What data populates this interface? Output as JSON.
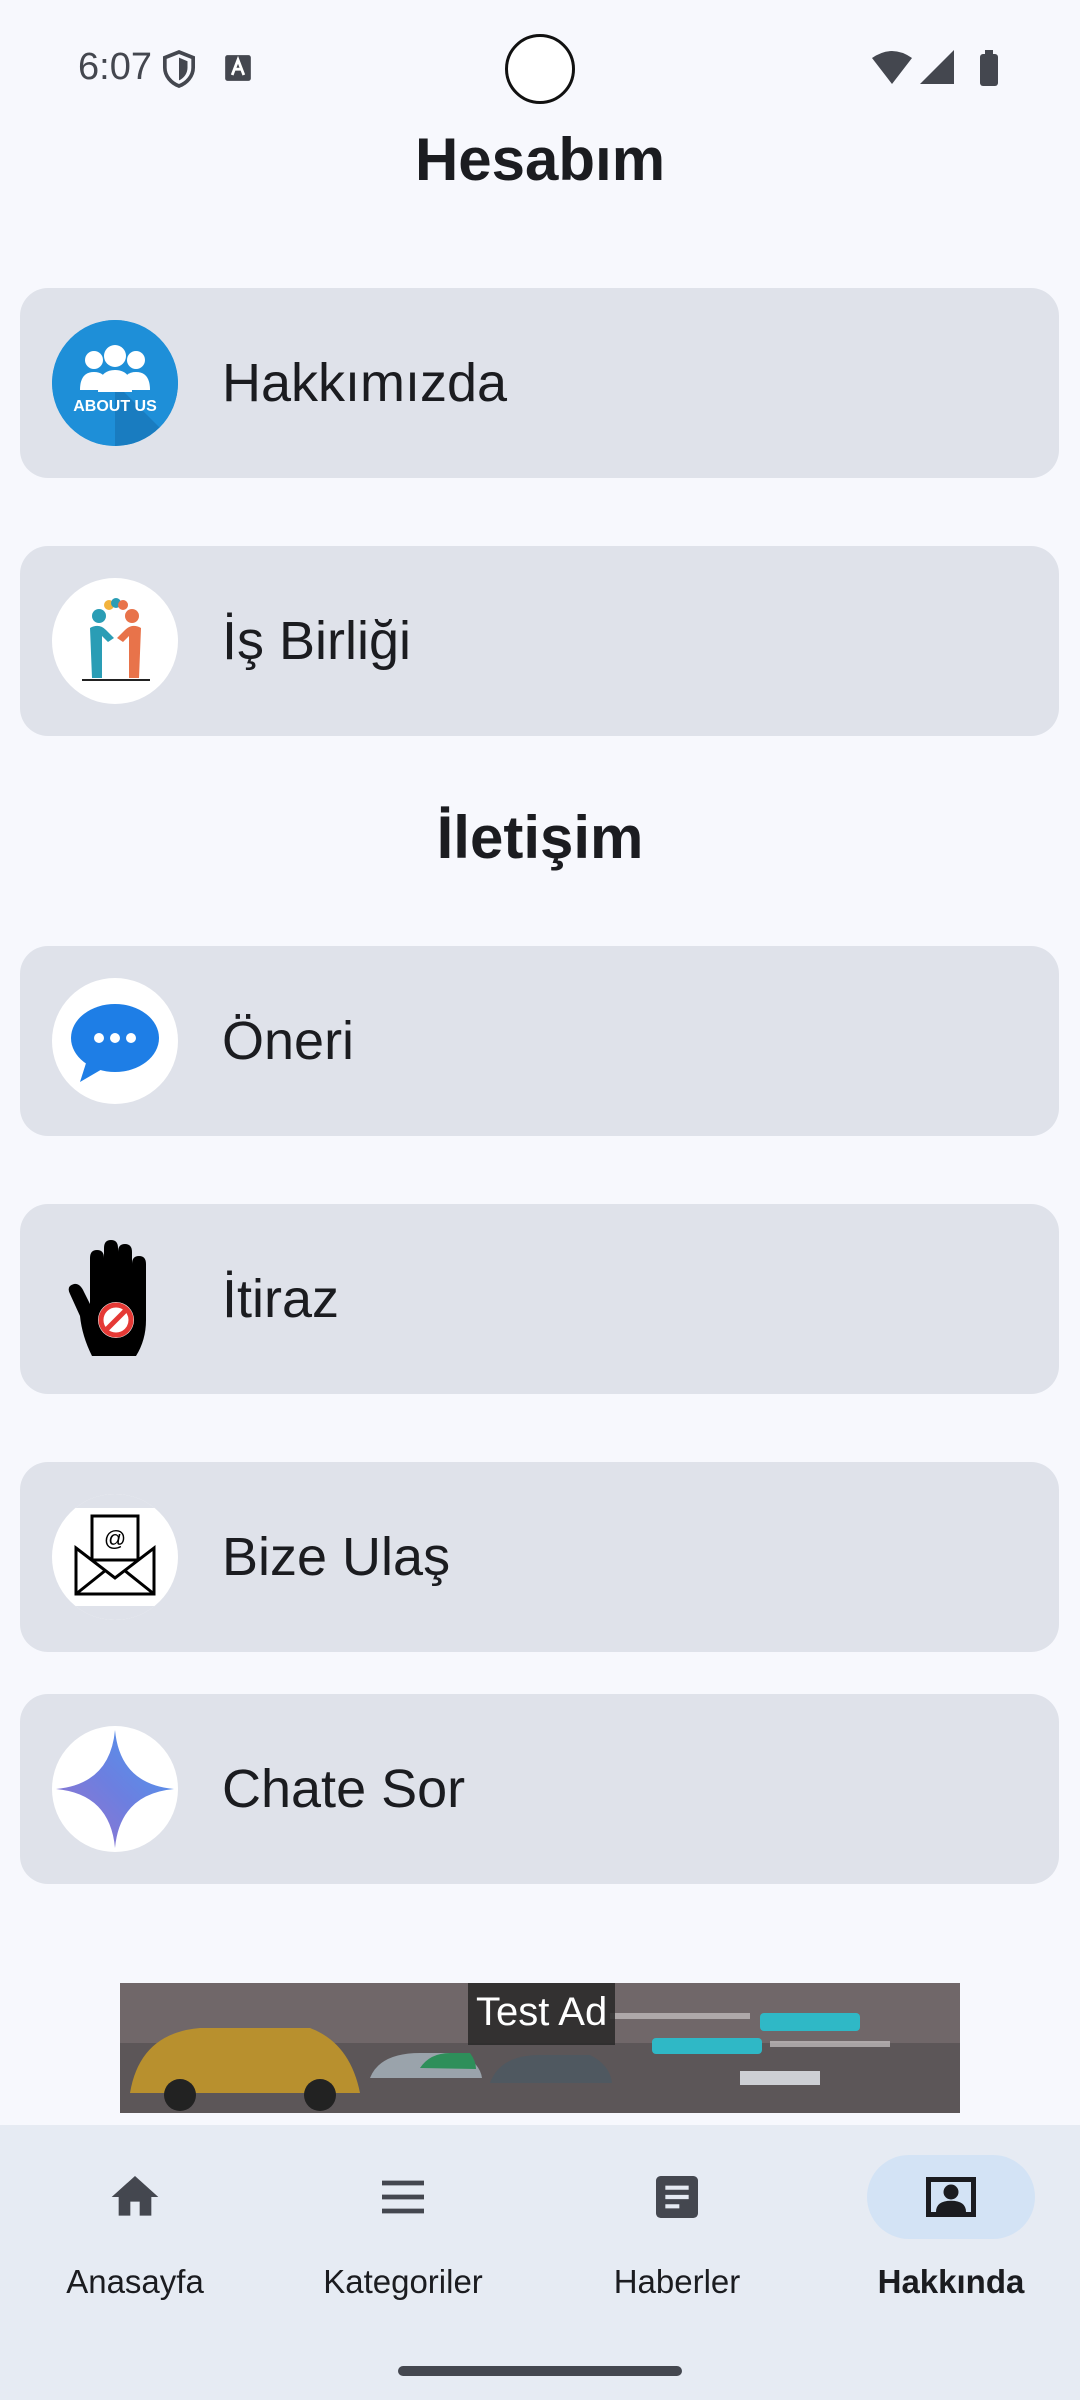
{
  "status_bar": {
    "time": "6:07"
  },
  "header": {
    "title": "Hesabım"
  },
  "account_items": [
    {
      "label": "Hakkımızda",
      "icon": "about-us-icon",
      "icon_text": "ABOUT US"
    },
    {
      "label": "İş Birliği",
      "icon": "handshake-icon"
    }
  ],
  "contact_section": {
    "title": "İletişim"
  },
  "contact_items": [
    {
      "label": "Öneri",
      "icon": "chat-bubble-icon"
    },
    {
      "label": "İtiraz",
      "icon": "stop-hand-icon"
    },
    {
      "label": "Bize Ulaş",
      "icon": "envelope-icon"
    },
    {
      "label": "Chate Sor",
      "icon": "sparkle-icon"
    }
  ],
  "ad": {
    "label": "Test Ad"
  },
  "bottom_nav": {
    "items": [
      {
        "label": "Anasayfa",
        "icon": "home-icon"
      },
      {
        "label": "Kategoriler",
        "icon": "menu-icon"
      },
      {
        "label": "Haberler",
        "icon": "article-icon"
      },
      {
        "label": "Hakkında",
        "icon": "account-box-icon",
        "active": true
      }
    ]
  },
  "colors": {
    "background": "#f7f8fd",
    "card": "#dfe2ea",
    "nav_background": "#e6ebf3",
    "nav_active_pill": "#d3e3f5",
    "text": "#1b1c20"
  }
}
